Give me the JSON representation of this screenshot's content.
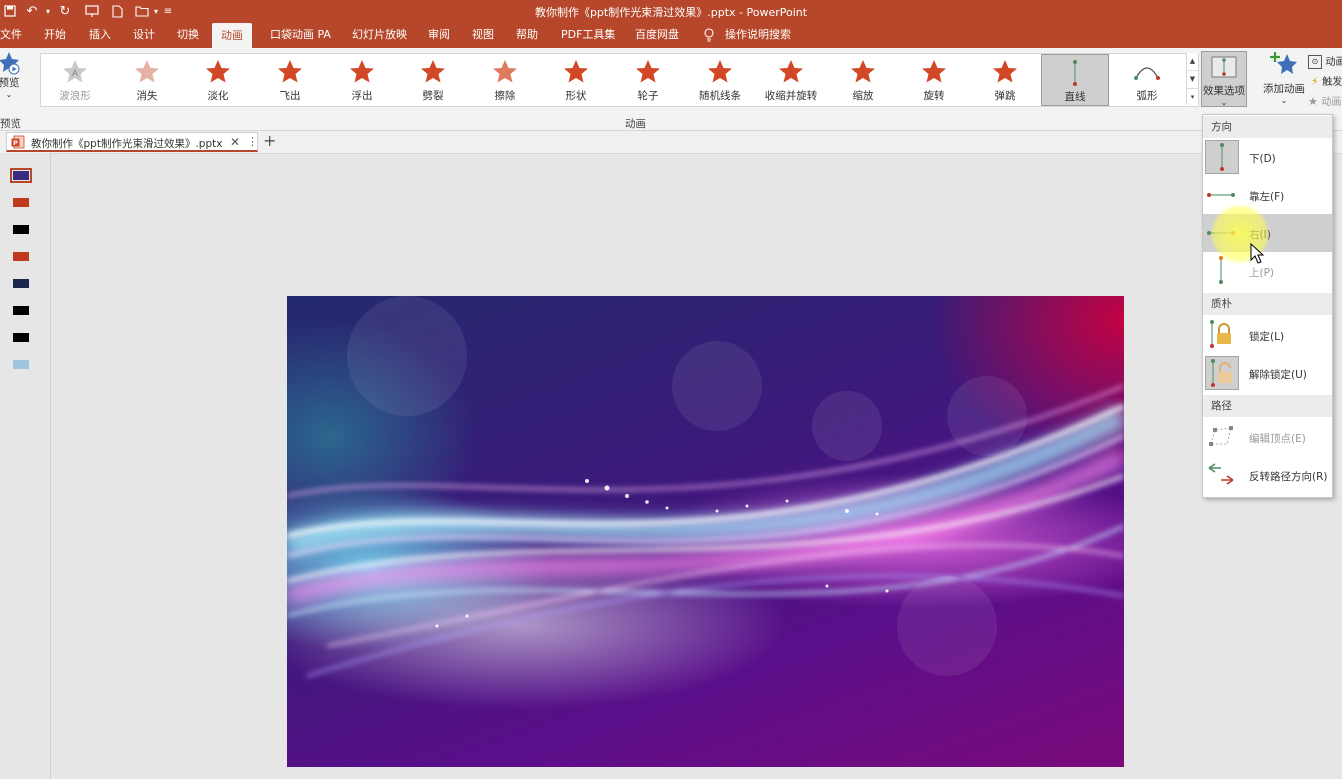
{
  "window": {
    "title": "教你制作《ppt制作光束滑过效果》.pptx  -  PowerPoint"
  },
  "tabs": [
    "文件",
    "开始",
    "插入",
    "设计",
    "切换",
    "动画",
    "口袋动画 PA",
    "幻灯片放映",
    "审阅",
    "视图",
    "帮助",
    "PDF工具集",
    "百度网盘"
  ],
  "active_tab": "动画",
  "search": {
    "label": "操作说明搜索"
  },
  "ribbon": {
    "preview_label": "预览",
    "preview_group": "预览",
    "group_label": "动画",
    "animations": [
      {
        "label": "波浪形",
        "color": "#c9c9c9"
      },
      {
        "label": "消失",
        "color": "#e6b2a5"
      },
      {
        "label": "淡化",
        "color": "#d24726"
      },
      {
        "label": "飞出",
        "color": "#d24726"
      },
      {
        "label": "浮出",
        "color": "#d24726"
      },
      {
        "label": "劈裂",
        "color": "#d24726"
      },
      {
        "label": "擦除",
        "color": "#e07a5f"
      },
      {
        "label": "形状",
        "color": "#d24726"
      },
      {
        "label": "轮子",
        "color": "#d24726"
      },
      {
        "label": "随机线条",
        "color": "#d24726"
      },
      {
        "label": "收缩并旋转",
        "color": "#d24726"
      },
      {
        "label": "缩放",
        "color": "#d24726"
      },
      {
        "label": "旋转",
        "color": "#d24726"
      },
      {
        "label": "弹跳",
        "color": "#d24726"
      },
      {
        "label": "直线",
        "color": ""
      },
      {
        "label": "弧形",
        "color": ""
      }
    ],
    "selected_animation": "直线",
    "effect_options_label": "效果选项",
    "add_animation_label": "添加动画",
    "side_labels": [
      "动画",
      "触发",
      "动画"
    ]
  },
  "document_tab": {
    "name": "教你制作《ppt制作光束滑过效果》.pptx"
  },
  "thumbnails": [
    {
      "color": "#3a2a80",
      "selected": true
    },
    {
      "color": "#c03a1e",
      "selected": false
    },
    {
      "color": "#000000",
      "selected": false
    },
    {
      "color": "#c03a1e",
      "selected": false
    },
    {
      "color": "#1b2650",
      "selected": false
    },
    {
      "color": "#000000",
      "selected": false
    },
    {
      "color": "#000000",
      "selected": false
    },
    {
      "color": "#9ec4e0",
      "selected": false
    }
  ],
  "dropdown": {
    "sections": [
      {
        "header": "方向",
        "items": [
          {
            "label": "下(D)",
            "state": "selected"
          },
          {
            "label": "靠左(F)",
            "state": "normal"
          },
          {
            "label": "右(I)",
            "state": "hover"
          },
          {
            "label": "上(P)",
            "state": "dim"
          }
        ]
      },
      {
        "header": "质朴",
        "items": [
          {
            "label": "锁定(L)",
            "state": "normal"
          },
          {
            "label": "解除锁定(U)",
            "state": "selected"
          }
        ]
      },
      {
        "header": "路径",
        "items": [
          {
            "label": "编辑顶点(E)",
            "state": "dim"
          },
          {
            "label": "反转路径方向(R)",
            "state": "normal"
          }
        ]
      }
    ]
  },
  "colors": {
    "accent": "#b7472a",
    "anim_star": "#d24726"
  }
}
